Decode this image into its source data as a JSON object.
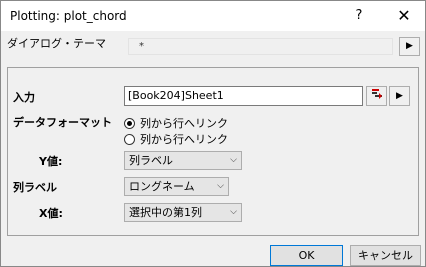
{
  "window": {
    "title": "Plotting: plot_chord",
    "help_label": "?",
    "close_label": "✕"
  },
  "theme": {
    "label": "ダイアログ・テーマ",
    "value": "*",
    "arrow": "▶"
  },
  "form": {
    "input_label": "入力",
    "input_value": "[Book204]Sheet1",
    "data_format_label": "データフォーマット",
    "data_format_options": [
      "列から行へリンク",
      "列から行へリンク"
    ],
    "data_format_selected": 0,
    "y_label": "Y値:",
    "y_value": "列ラベル",
    "col_label_label": "列ラベル",
    "col_label_value": "ロングネーム",
    "x_label": "X値:",
    "x_value": "選択中の第1列"
  },
  "footer": {
    "ok_label": "OK",
    "cancel_label": "キャンセル"
  },
  "icons": {
    "chevron": "⌵",
    "arrow_right": "▶"
  }
}
